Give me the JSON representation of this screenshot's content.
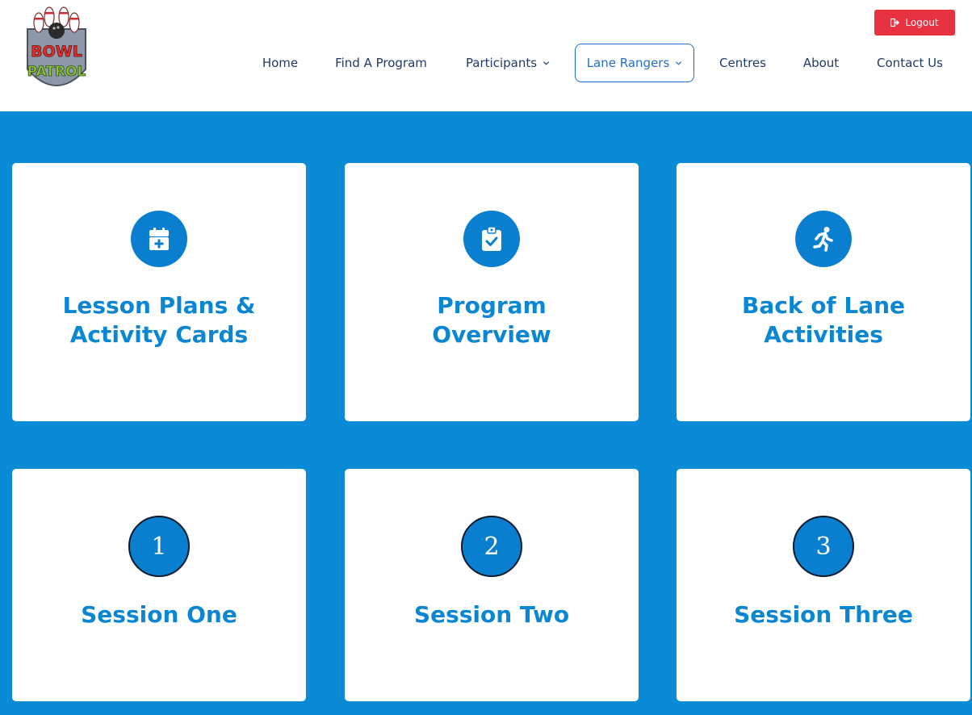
{
  "brand": {
    "logo_top": "BOWL",
    "logo_bottom": "PATROL"
  },
  "header": {
    "logout_label": "Logout"
  },
  "nav": {
    "items": [
      {
        "label": "Home"
      },
      {
        "label": "Find A Program"
      },
      {
        "label": "Participants"
      },
      {
        "label": "Lane Rangers"
      },
      {
        "label": "Centres"
      },
      {
        "label": "About"
      },
      {
        "label": "Contact Us"
      }
    ]
  },
  "cards": [
    {
      "title": "Lesson Plans &\nActivity Cards",
      "icon": "calendar-plus-icon"
    },
    {
      "title": "Program\nOverview",
      "icon": "clipboard-check-icon"
    },
    {
      "title": "Back of Lane\nActivities",
      "icon": "running-icon"
    },
    {
      "title": "Session One",
      "number": "1"
    },
    {
      "title": "Session Two",
      "number": "2"
    },
    {
      "title": "Session Three",
      "number": "3"
    }
  ],
  "colors": {
    "brand_blue": "#0b8bd6",
    "title_blue": "#0a86d3",
    "nav_text": "#1f3a6b",
    "active_border": "#1f6fd1",
    "logout_red": "#e8323f"
  }
}
